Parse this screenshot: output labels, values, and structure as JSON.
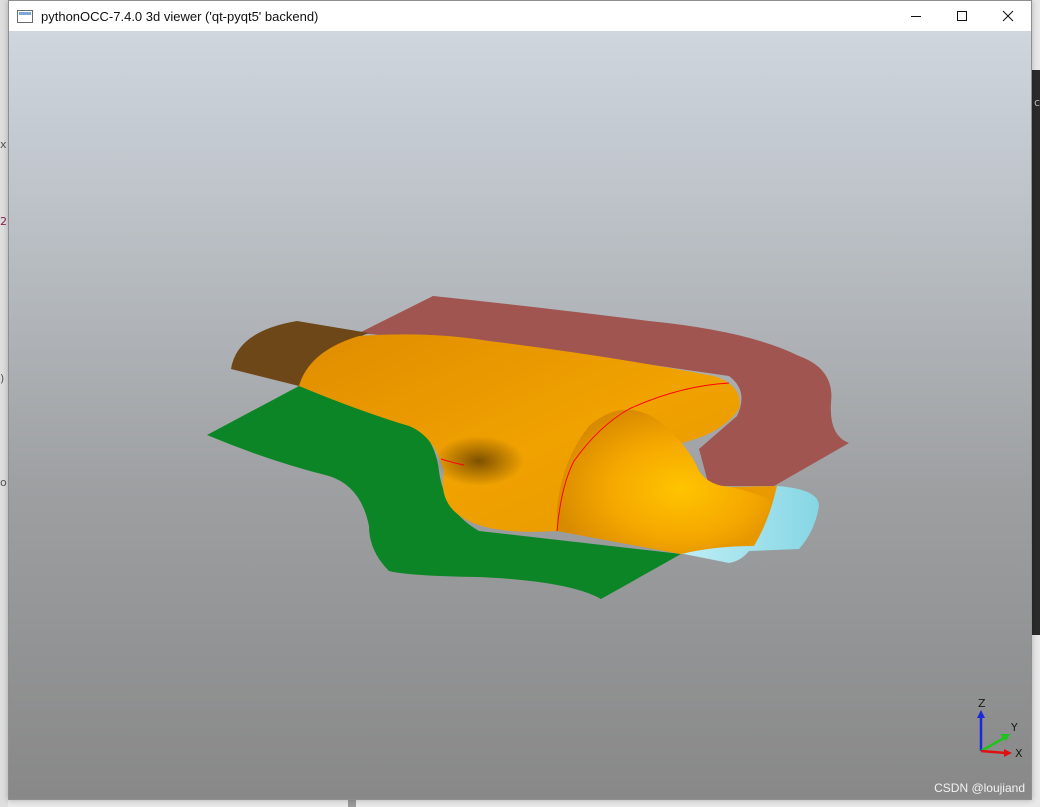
{
  "window": {
    "title": "pythonOCC-7.4.0 3d viewer ('qt-pyqt5' backend)"
  },
  "controls": {
    "minimize_icon": "minimize-icon",
    "maximize_icon": "maximize-icon",
    "close_icon": "close-icon"
  },
  "viewer": {
    "background_top": "#cfd6de",
    "background_bottom": "#888888",
    "surfaces": {
      "green": "#0b8526",
      "rose": "#a05550",
      "brown": "#6e4718",
      "orange": "#f0a000",
      "cyan": "#8fdbe8"
    },
    "edge_color": "#ff0000"
  },
  "triedron": {
    "z_label": "Z",
    "y_label": "Y",
    "x_label": "X"
  },
  "watermark": "CSDN @loujiand",
  "background_fragments": {
    "left_1": "x",
    "left_2": "2",
    "left_3": ")",
    "left_4": "o",
    "right_1": "c"
  }
}
